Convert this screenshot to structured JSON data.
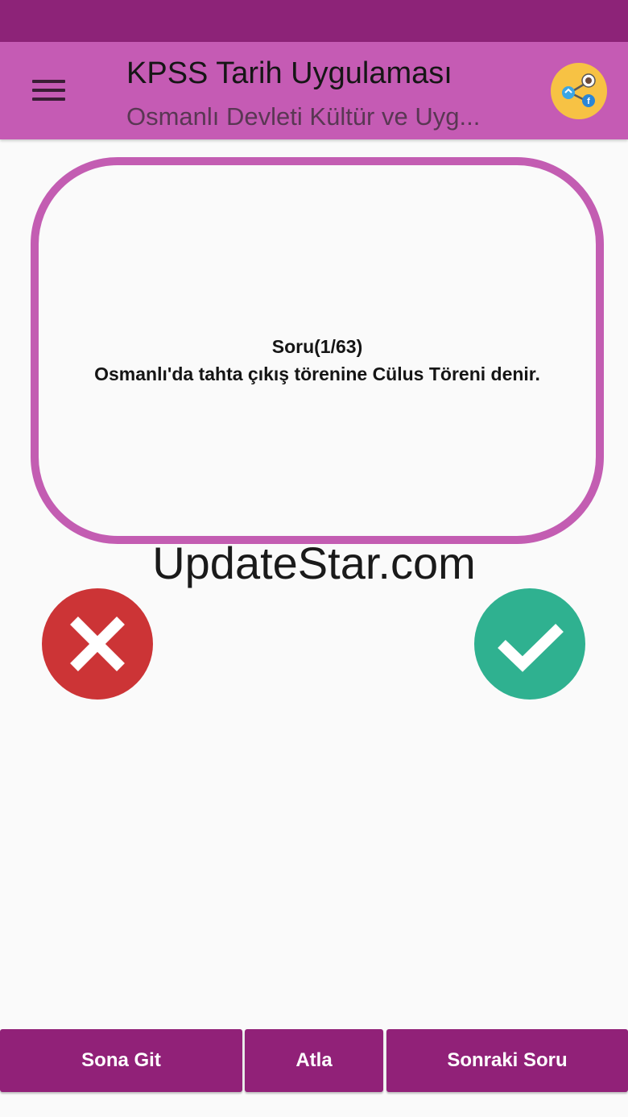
{
  "app_bar": {
    "title": "KPSS Tarih Uygulaması",
    "subtitle": "Osmanlı Devleti Kültür ve Uyg...",
    "menu_icon": "hamburger-menu-icon",
    "share_icon": "share-network-icon"
  },
  "question": {
    "counter": "Soru(1/63)",
    "text": "Osmanlı'da tahta çıkış törenine Cülus Töreni denir."
  },
  "watermark": "UpdateStar.com",
  "answers": {
    "wrong_icon": "close-x-icon",
    "correct_icon": "checkmark-icon"
  },
  "bottom_nav": {
    "end_label": "Sona Git",
    "skip_label": "Atla",
    "next_label": "Sonraki Soru"
  },
  "colors": {
    "status_bar": "#8d2378",
    "app_bar": "#c55bb4",
    "card_border": "#c35db2",
    "wrong": "#cc3436",
    "correct": "#2fb190",
    "nav_button": "#912178",
    "share_button": "#f7c244"
  }
}
